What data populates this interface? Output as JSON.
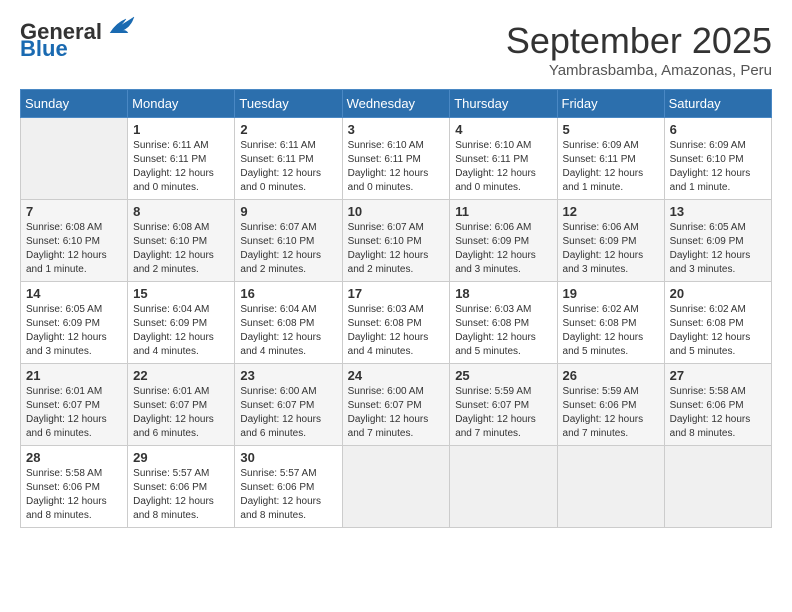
{
  "header": {
    "logo_general": "General",
    "logo_blue": "Blue",
    "month_title": "September 2025",
    "subtitle": "Yambrasbamba, Amazonas, Peru"
  },
  "days_of_week": [
    "Sunday",
    "Monday",
    "Tuesday",
    "Wednesday",
    "Thursday",
    "Friday",
    "Saturday"
  ],
  "weeks": [
    [
      {
        "day": "",
        "info": ""
      },
      {
        "day": "1",
        "info": "Sunrise: 6:11 AM\nSunset: 6:11 PM\nDaylight: 12 hours\nand 0 minutes."
      },
      {
        "day": "2",
        "info": "Sunrise: 6:11 AM\nSunset: 6:11 PM\nDaylight: 12 hours\nand 0 minutes."
      },
      {
        "day": "3",
        "info": "Sunrise: 6:10 AM\nSunset: 6:11 PM\nDaylight: 12 hours\nand 0 minutes."
      },
      {
        "day": "4",
        "info": "Sunrise: 6:10 AM\nSunset: 6:11 PM\nDaylight: 12 hours\nand 0 minutes."
      },
      {
        "day": "5",
        "info": "Sunrise: 6:09 AM\nSunset: 6:11 PM\nDaylight: 12 hours\nand 1 minute."
      },
      {
        "day": "6",
        "info": "Sunrise: 6:09 AM\nSunset: 6:10 PM\nDaylight: 12 hours\nand 1 minute."
      }
    ],
    [
      {
        "day": "7",
        "info": "Sunrise: 6:08 AM\nSunset: 6:10 PM\nDaylight: 12 hours\nand 1 minute."
      },
      {
        "day": "8",
        "info": "Sunrise: 6:08 AM\nSunset: 6:10 PM\nDaylight: 12 hours\nand 2 minutes."
      },
      {
        "day": "9",
        "info": "Sunrise: 6:07 AM\nSunset: 6:10 PM\nDaylight: 12 hours\nand 2 minutes."
      },
      {
        "day": "10",
        "info": "Sunrise: 6:07 AM\nSunset: 6:10 PM\nDaylight: 12 hours\nand 2 minutes."
      },
      {
        "day": "11",
        "info": "Sunrise: 6:06 AM\nSunset: 6:09 PM\nDaylight: 12 hours\nand 3 minutes."
      },
      {
        "day": "12",
        "info": "Sunrise: 6:06 AM\nSunset: 6:09 PM\nDaylight: 12 hours\nand 3 minutes."
      },
      {
        "day": "13",
        "info": "Sunrise: 6:05 AM\nSunset: 6:09 PM\nDaylight: 12 hours\nand 3 minutes."
      }
    ],
    [
      {
        "day": "14",
        "info": "Sunrise: 6:05 AM\nSunset: 6:09 PM\nDaylight: 12 hours\nand 3 minutes."
      },
      {
        "day": "15",
        "info": "Sunrise: 6:04 AM\nSunset: 6:09 PM\nDaylight: 12 hours\nand 4 minutes."
      },
      {
        "day": "16",
        "info": "Sunrise: 6:04 AM\nSunset: 6:08 PM\nDaylight: 12 hours\nand 4 minutes."
      },
      {
        "day": "17",
        "info": "Sunrise: 6:03 AM\nSunset: 6:08 PM\nDaylight: 12 hours\nand 4 minutes."
      },
      {
        "day": "18",
        "info": "Sunrise: 6:03 AM\nSunset: 6:08 PM\nDaylight: 12 hours\nand 5 minutes."
      },
      {
        "day": "19",
        "info": "Sunrise: 6:02 AM\nSunset: 6:08 PM\nDaylight: 12 hours\nand 5 minutes."
      },
      {
        "day": "20",
        "info": "Sunrise: 6:02 AM\nSunset: 6:08 PM\nDaylight: 12 hours\nand 5 minutes."
      }
    ],
    [
      {
        "day": "21",
        "info": "Sunrise: 6:01 AM\nSunset: 6:07 PM\nDaylight: 12 hours\nand 6 minutes."
      },
      {
        "day": "22",
        "info": "Sunrise: 6:01 AM\nSunset: 6:07 PM\nDaylight: 12 hours\nand 6 minutes."
      },
      {
        "day": "23",
        "info": "Sunrise: 6:00 AM\nSunset: 6:07 PM\nDaylight: 12 hours\nand 6 minutes."
      },
      {
        "day": "24",
        "info": "Sunrise: 6:00 AM\nSunset: 6:07 PM\nDaylight: 12 hours\nand 7 minutes."
      },
      {
        "day": "25",
        "info": "Sunrise: 5:59 AM\nSunset: 6:07 PM\nDaylight: 12 hours\nand 7 minutes."
      },
      {
        "day": "26",
        "info": "Sunrise: 5:59 AM\nSunset: 6:06 PM\nDaylight: 12 hours\nand 7 minutes."
      },
      {
        "day": "27",
        "info": "Sunrise: 5:58 AM\nSunset: 6:06 PM\nDaylight: 12 hours\nand 8 minutes."
      }
    ],
    [
      {
        "day": "28",
        "info": "Sunrise: 5:58 AM\nSunset: 6:06 PM\nDaylight: 12 hours\nand 8 minutes."
      },
      {
        "day": "29",
        "info": "Sunrise: 5:57 AM\nSunset: 6:06 PM\nDaylight: 12 hours\nand 8 minutes."
      },
      {
        "day": "30",
        "info": "Sunrise: 5:57 AM\nSunset: 6:06 PM\nDaylight: 12 hours\nand 8 minutes."
      },
      {
        "day": "",
        "info": ""
      },
      {
        "day": "",
        "info": ""
      },
      {
        "day": "",
        "info": ""
      },
      {
        "day": "",
        "info": ""
      }
    ]
  ]
}
